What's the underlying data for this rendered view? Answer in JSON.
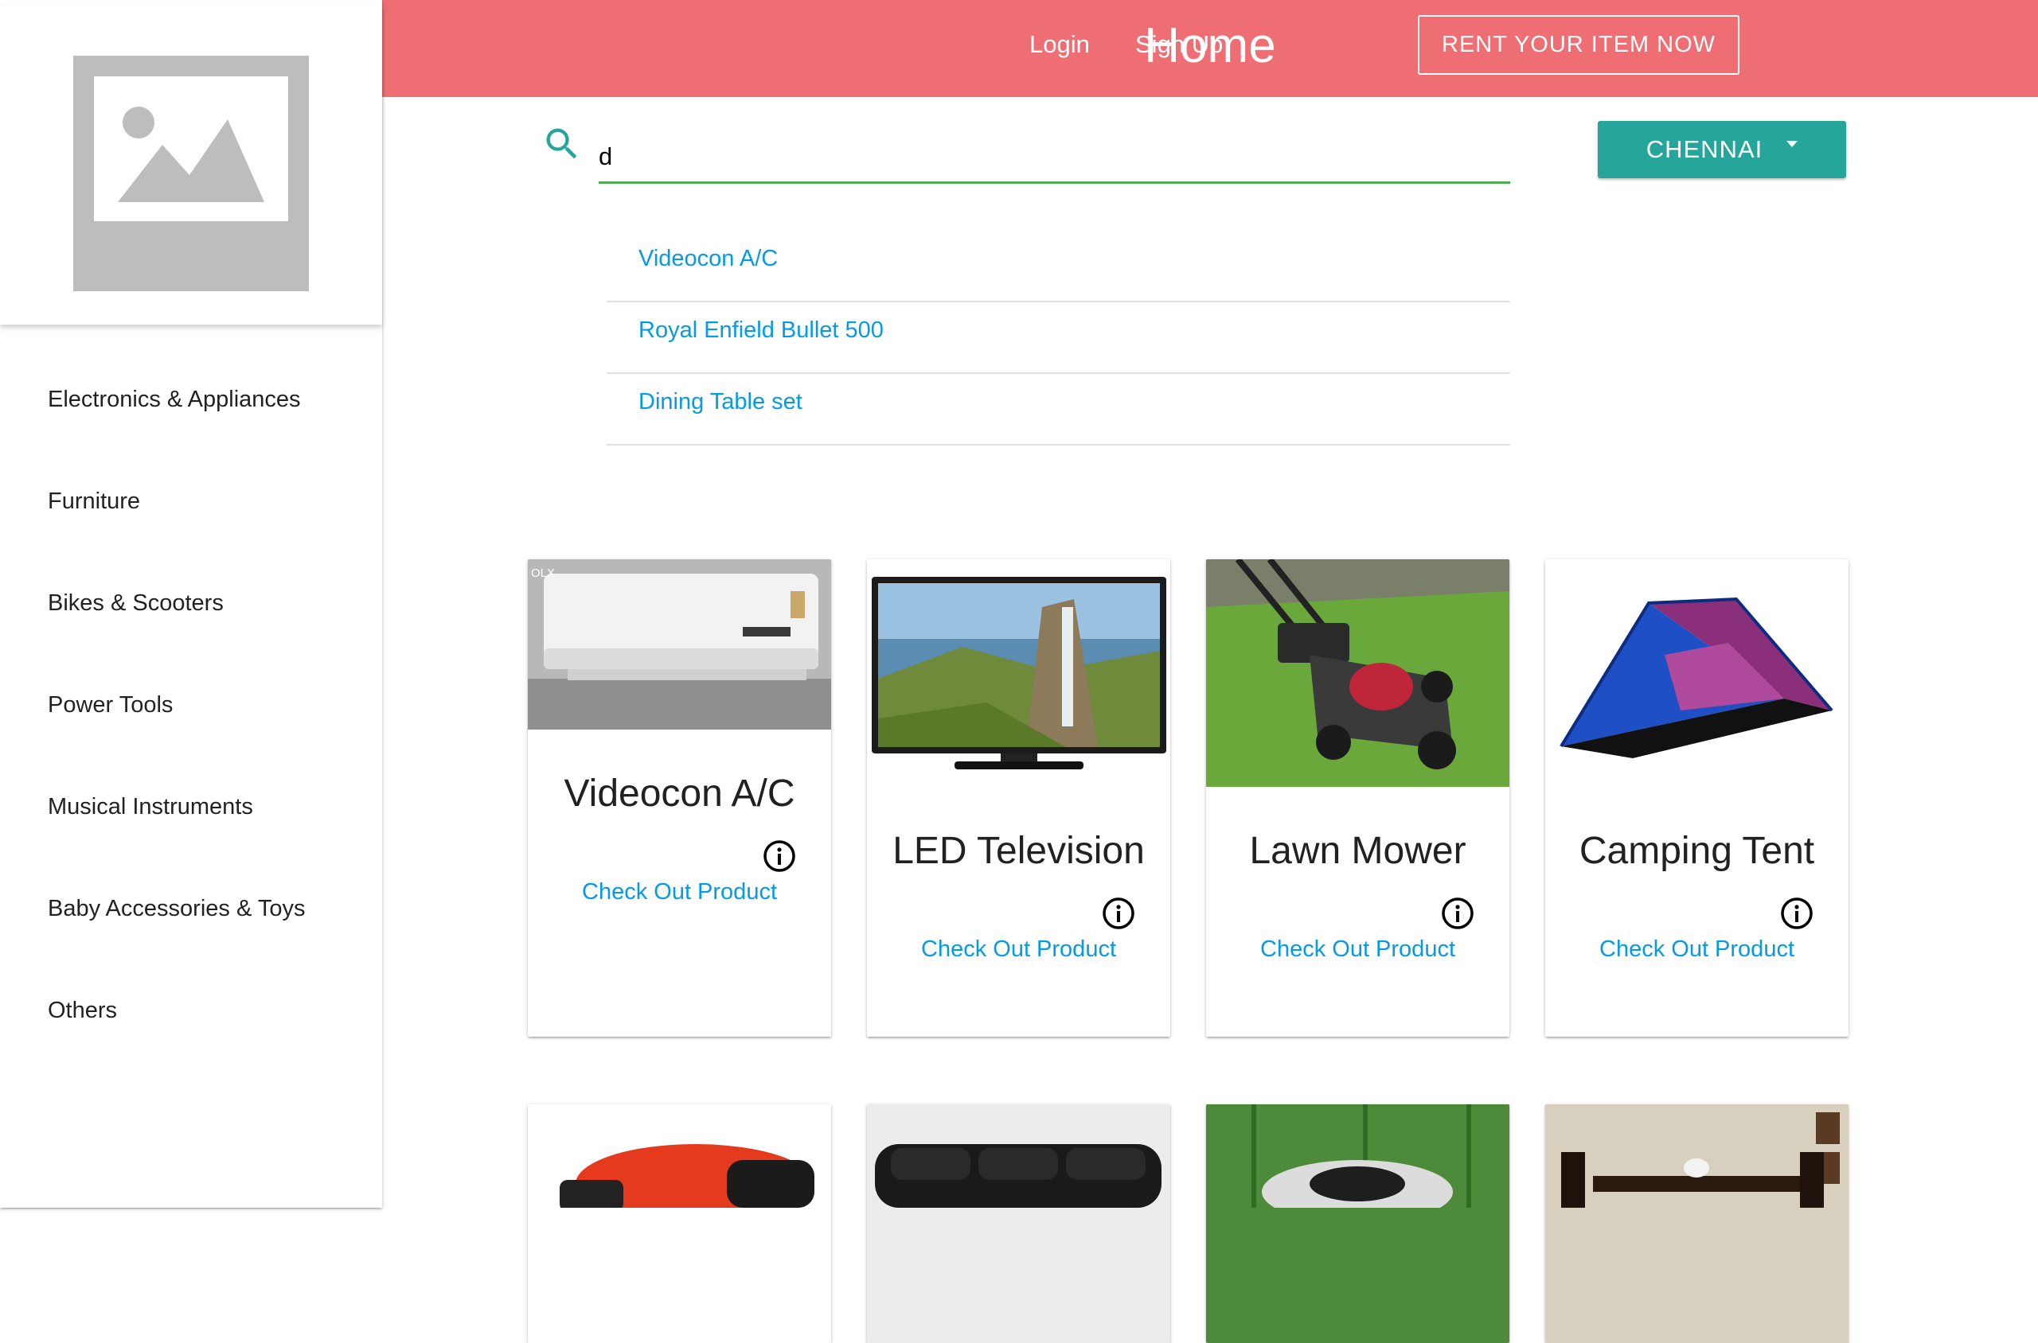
{
  "header": {
    "title": "Home",
    "rent_button": "RENT YOUR ITEM NOW",
    "login": "Login",
    "signup": "Sign Up",
    "background_color": "#ee6e73"
  },
  "sidebar": {
    "logo_icon": "image-placeholder-icon",
    "categories": [
      "Electronics & Appliances",
      "Furniture",
      "Bikes & Scooters",
      "Power Tools",
      "Musical Instruments",
      "Baby Accessories & Toys",
      "Others"
    ]
  },
  "search": {
    "value": "d",
    "icon": "search-icon",
    "suggestions": [
      "Videocon A/C",
      "Royal Enfield Bullet 500",
      "Dining Table set"
    ]
  },
  "city": {
    "label": "CHENNAI",
    "color": "#26a69a"
  },
  "products": [
    {
      "title": "Videocon A/C",
      "link": "Check Out Product"
    },
    {
      "title": "LED Television",
      "link": "Check Out Product"
    },
    {
      "title": "Lawn Mower",
      "link": "Check Out Product"
    },
    {
      "title": "Camping Tent",
      "link": "Check Out Product"
    }
  ],
  "colors": {
    "link": "#039be5",
    "search_underline": "#4caf50"
  }
}
